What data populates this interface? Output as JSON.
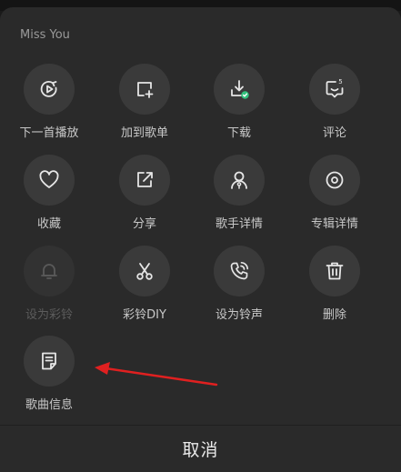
{
  "sheet": {
    "title": "Miss You"
  },
  "actions": [
    {
      "label": "下一首播放",
      "icon": "play-next-icon",
      "enabled": true
    },
    {
      "label": "加到歌单",
      "icon": "add-to-playlist-icon",
      "enabled": true
    },
    {
      "label": "下载",
      "icon": "download-icon",
      "enabled": true
    },
    {
      "label": "评论",
      "icon": "comment-icon",
      "enabled": true,
      "badge": "5"
    },
    {
      "label": "收藏",
      "icon": "heart-icon",
      "enabled": true
    },
    {
      "label": "分享",
      "icon": "share-icon",
      "enabled": true
    },
    {
      "label": "歌手详情",
      "icon": "singer-icon",
      "enabled": true
    },
    {
      "label": "专辑详情",
      "icon": "album-icon",
      "enabled": true
    },
    {
      "label": "设为彩铃",
      "icon": "bell-icon",
      "enabled": false
    },
    {
      "label": "彩铃DIY",
      "icon": "scissors-icon",
      "enabled": true
    },
    {
      "label": "设为铃声",
      "icon": "phone-ring-icon",
      "enabled": true
    },
    {
      "label": "删除",
      "icon": "trash-icon",
      "enabled": true
    },
    {
      "label": "歌曲信息",
      "icon": "song-info-icon",
      "enabled": true
    }
  ],
  "footer": {
    "cancel_label": "取消"
  },
  "colors": {
    "accent_check": "#31c27c",
    "annotation_arrow": "#e02020"
  }
}
